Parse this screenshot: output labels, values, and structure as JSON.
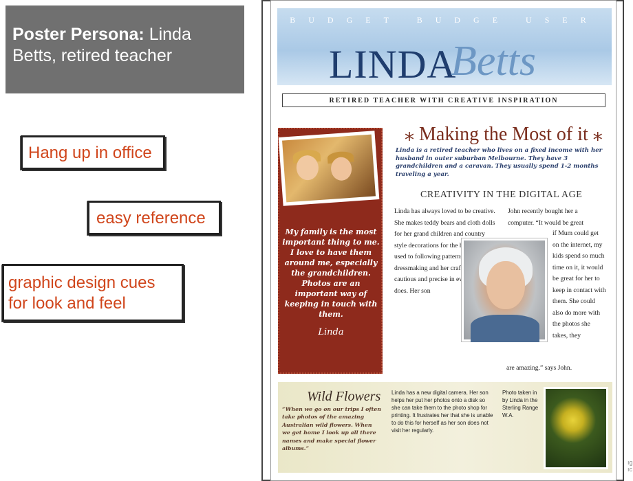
{
  "left": {
    "persona_bold": "Poster Persona:",
    "persona_rest": " Linda",
    "persona_line2": "Betts, retired teacher",
    "stamps": [
      {
        "text": "Hang up in office"
      },
      {
        "text": "easy reference"
      },
      {
        "text_line1": "graphic design cues",
        "text_line2": "for look and feel"
      }
    ]
  },
  "poster": {
    "budget_line": "BUDGET BUDGE USER",
    "name_first": "LINDA",
    "name_last": "Betts",
    "subtitle": "RETIRED TEACHER WITH CREATIVE INSPIRATION",
    "heading": "⁎ Making the Most of it ⁎",
    "intro": "Linda is a retired teacher who lives on a fixed income with her husband in outer suburban Melbourne. They have 3 grandchildren and a caravan. They usually spend 1-2 months traveling a year.",
    "subheading": "CREATIVITY IN THE DIGITAL AGE",
    "red_quote": "My family is the most important thing to me. I love to have them around me, especially the grandchildren. Photos are an important way of keeping in touch with them.",
    "signature": "Linda",
    "col1_text": "Linda has always loved to be creative. She makes teddy bears and cloth dolls for her grand children and country style decorations for the house. She is used to following patterns in dressmaking and her craft work. She is cautious and precise in everything she does. Her son",
    "col2_top": "John recently bought her a computer. “It would be great",
    "col2_right": "if Mum could get on the internet, my kids spend so much time on it, it would be great for her to keep in contact with them. She could also do more with the photos she takes, they",
    "col2_end": "are amazing.” says John.",
    "wild_flowers_title": "Wild Flowers",
    "wild_flowers_quote": "“When we go on our trips I often take photos of the amazing Australian wild flowers. When we get home I look up all there names and make special flower albums.”",
    "wf_body": "Linda has a new digital camera. Her son helps her put her photos onto a disk so she can take them to the photo shop for printing. It frustrates her that she is unable to do this for herself as her son does not visit her regularly.",
    "wf_caption": "Photo taken in by Linda in the Sterling Range W.A."
  },
  "edge_text": "ıg\nıc"
}
